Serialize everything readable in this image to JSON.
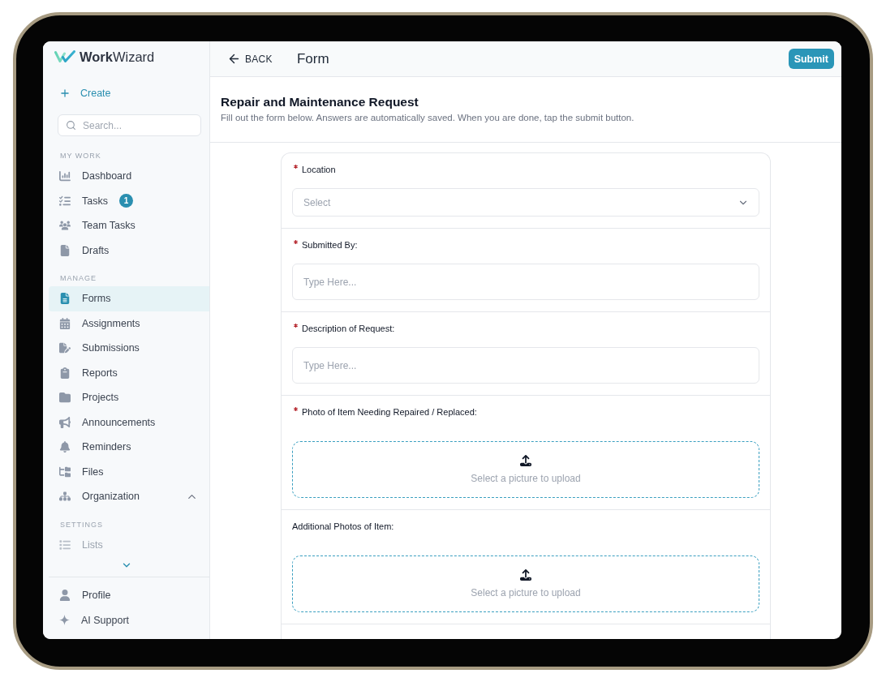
{
  "logo": {
    "text": "**Work**Wizard"
  },
  "sidebar": {
    "create": "Create",
    "search": {
      "placeholder": "Search..."
    },
    "sections": [
      {
        "heading": "MY WORK",
        "items": [
          {
            "label": "Dashboard",
            "selected": false,
            "faded": false
          },
          {
            "label": "Tasks",
            "badge": "1",
            "selected": false,
            "faded": false
          },
          {
            "label": "Team Tasks",
            "selected": false,
            "faded": false
          },
          {
            "label": "Drafts",
            "selected": false,
            "faded": false
          }
        ]
      },
      {
        "heading": "MANAGE",
        "items": [
          {
            "label": "Forms",
            "selected": true,
            "faded": false
          },
          {
            "label": "Assignments",
            "selected": false,
            "faded": false
          },
          {
            "label": "Submissions",
            "selected": false,
            "faded": false
          },
          {
            "label": "Reports",
            "selected": false,
            "faded": false
          },
          {
            "label": "Projects",
            "selected": false,
            "faded": false
          },
          {
            "label": "Announcements",
            "selected": false,
            "faded": false
          },
          {
            "label": "Reminders",
            "selected": false,
            "faded": false
          },
          {
            "label": "Files",
            "selected": false,
            "faded": false
          },
          {
            "label": "Organization",
            "expanded": true,
            "selected": false,
            "faded": false
          }
        ]
      },
      {
        "heading": "SETTINGS",
        "items": [
          {
            "label": "Lists",
            "selected": false,
            "faded": true
          }
        ]
      }
    ],
    "footer_items": [
      {
        "label": "Profile",
        "selected": false
      },
      {
        "label": "AI Support",
        "selected": false
      }
    ]
  },
  "header": {
    "back": "BACK",
    "title": "Form",
    "submit": "Submit"
  },
  "form": {
    "title": "Repair and Maintenance Request",
    "description": "Fill out the form below. Answers are automatically saved. When you are done, tap the submit button.",
    "fields": [
      {
        "kind": "select",
        "label": "Location",
        "required": true,
        "placeholder": "Select"
      },
      {
        "kind": "text",
        "label": "Submitted By:",
        "required": true,
        "placeholder": "Type Here..."
      },
      {
        "kind": "text",
        "label": "Description of Request:",
        "required": true,
        "placeholder": "Type Here..."
      },
      {
        "kind": "upload",
        "label": "Photo of Item Needing Repaired / Replaced:",
        "required": true,
        "prompt": "Select a picture to upload"
      },
      {
        "kind": "upload",
        "label": "Additional Photos of Item:",
        "required": false,
        "prompt": "Select a picture to upload"
      }
    ]
  }
}
